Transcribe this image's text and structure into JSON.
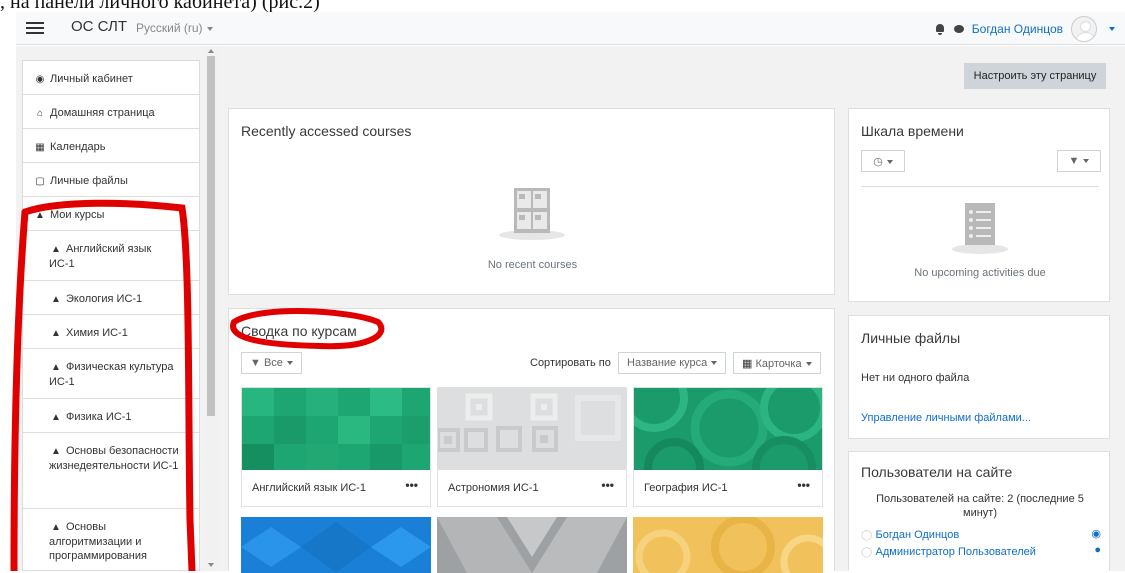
{
  "caption": ", на панели личного кабинета) (рис.2)",
  "header": {
    "brand": "ОС СЛТ",
    "language": "Русский (ru)",
    "user_name": "Богдан Одинцов"
  },
  "sidebar": {
    "items": [
      {
        "label": "Личный кабинет",
        "icon": "dashboard-icon"
      },
      {
        "label": "Домашняя страница",
        "icon": "home-icon"
      },
      {
        "label": "Календарь",
        "icon": "calendar-icon"
      },
      {
        "label": "Личные файлы",
        "icon": "file-icon"
      },
      {
        "label": "Мои курсы",
        "icon": "graduation-cap-icon"
      },
      {
        "label": "Английский язык ИС-1",
        "icon": "graduation-cap-icon"
      },
      {
        "label": "Экология ИС-1",
        "icon": "graduation-cap-icon"
      },
      {
        "label": "Химия ИС-1",
        "icon": "graduation-cap-icon"
      },
      {
        "label": "Физическая культура ИС-1",
        "icon": "graduation-cap-icon"
      },
      {
        "label": "Физика ИС-1",
        "icon": "graduation-cap-icon"
      },
      {
        "label": "Основы безопасности жизнедеятельности ИС-1",
        "icon": "graduation-cap-icon"
      },
      {
        "label": "Основы алгоритмизации и программирования",
        "icon": "graduation-cap-icon"
      }
    ]
  },
  "main": {
    "customize_label": "Настроить эту страницу",
    "recent": {
      "title": "Recently accessed courses",
      "empty": "No recent courses"
    },
    "overview": {
      "title": "Сводка по курсам",
      "filter_label": "Все",
      "sort_label": "Сортировать по",
      "sort_value": "Название курса",
      "view_value": "Карточка",
      "courses": [
        {
          "name": "Английский язык ИС-1",
          "color": "#1ea672"
        },
        {
          "name": "Астрономия ИС-1",
          "color": "#d9dbdd"
        },
        {
          "name": "География ИС-1",
          "color": "#1b9a6c"
        }
      ]
    }
  },
  "right": {
    "timeline": {
      "title": "Шкала времени",
      "empty": "No upcoming activities due"
    },
    "files": {
      "title": "Личные файлы",
      "empty": "Нет ни одного файла",
      "manage_link": "Управление личными файлами..."
    },
    "online": {
      "title": "Пользователи на сайте",
      "summary": "Пользователей на сайте: 2 (последние 5 минут)",
      "users": [
        "Богдан Одинцов",
        "Администратор Пользователей"
      ]
    }
  },
  "colors": {
    "link": "#0f6fc5",
    "annotation": "#e00000"
  }
}
